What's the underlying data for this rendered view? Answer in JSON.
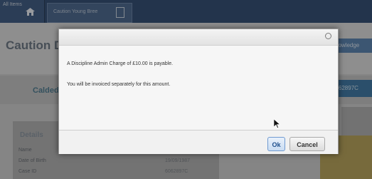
{
  "background": {
    "home_tab_label": "All Items",
    "case_tab_label": "Caution Young Bree",
    "page_title": "Caution D",
    "right_button_label": "knowledge",
    "person_name": "Calded",
    "person_id": "6062897C",
    "details_title": "Details",
    "detail_rows": [
      {
        "label": "Name",
        "value": ""
      },
      {
        "label": "Date of Birth",
        "value": "19/09/1987"
      },
      {
        "label": "Case ID",
        "value": "6062897C"
      }
    ]
  },
  "dialog": {
    "message_line_1": "A Discipline Admin Charge of £10.00 is payable.",
    "message_line_2": "You will be invoiced separately for this amount.",
    "ok_label": "Ok",
    "cancel_label": "Cancel"
  },
  "colors": {
    "accent": "#1f3d66",
    "ok_border": "#6f9ad1"
  },
  "icons": [
    "home-icon",
    "document-icon",
    "close-icon",
    "cursor-icon"
  ]
}
